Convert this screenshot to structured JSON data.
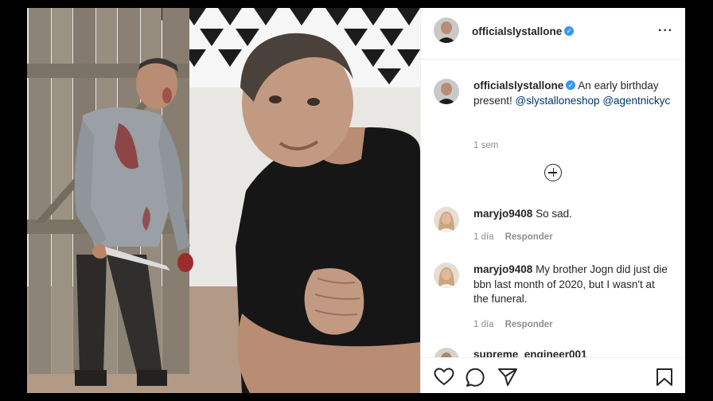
{
  "post": {
    "author": "officialslystallone",
    "caption_text": " An early birthday present! ",
    "caption_mention_1": "@slystalloneshop",
    "caption_mention_2": "@agentnickyc",
    "time": "1 sem"
  },
  "comments": [
    {
      "user": "maryjo9408",
      "text": " So sad.",
      "time": "1 día",
      "reply_label": "Responder"
    },
    {
      "user": "maryjo9408",
      "text": " My brother Jogn did just die bbn last month of 2020, but I wasn't at the funeral.",
      "time": "1 día",
      "reply_label": "Responder"
    },
    {
      "user": "supreme_engineer001"
    }
  ],
  "icons": {
    "more": "more-options-icon",
    "load_more": "plus-circle-icon",
    "like": "heart-icon",
    "comment": "comment-icon",
    "share": "share-icon",
    "save": "bookmark-icon",
    "verified": "verified-badge-icon"
  },
  "colors": {
    "verified": "#3897f0",
    "mention": "#00376b",
    "meta": "#8e8e8e",
    "text": "#262626"
  }
}
